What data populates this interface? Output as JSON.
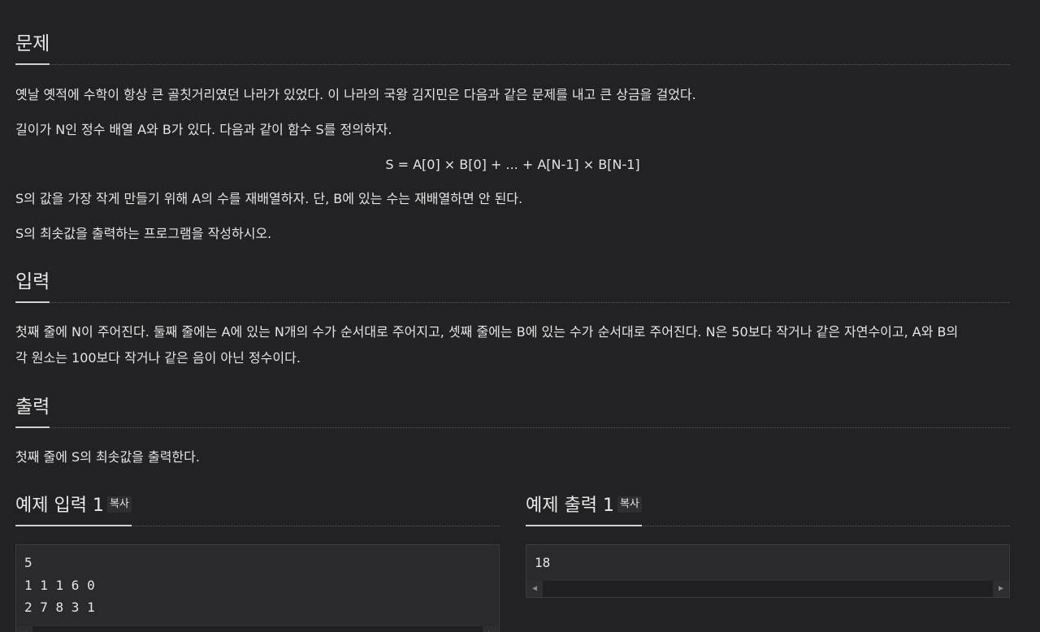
{
  "problem": {
    "heading": "문제",
    "p1": "옛날 옛적에 수학이 항상 큰 골칫거리였던 나라가 있었다. 이 나라의 국왕 김지민은 다음과 같은 문제를 내고 큰 상금을 걸었다.",
    "p2": "길이가 N인 정수 배열 A와 B가 있다. 다음과 같이 함수 S를 정의하자.",
    "formula": "S = A[0] × B[0] + ... + A[N-1] × B[N-1]",
    "p3": "S의 값을 가장 작게 만들기 위해 A의 수를 재배열하자. 단, B에 있는 수는 재배열하면 안 된다.",
    "p4": "S의 최솟값을 출력하는 프로그램을 작성하시오."
  },
  "input": {
    "heading": "입력",
    "line1": "첫째 줄에 N이 주어진다. 둘째 줄에는 A에 있는 N개의 수가 순서대로 주어지고, 셋째 줄에는 B에 있는 수가 순서대로 주어진다. N은 50보다 작거나 같은 자연수이고, A와 B의",
    "line2": "각 원소는 100보다 작거나 같은 음이 아닌 정수이다."
  },
  "output": {
    "heading": "출력",
    "text": "첫째 줄에 S의 최솟값을 출력한다."
  },
  "sample_input": {
    "heading": "예제 입력 1",
    "copy_label": "복사",
    "lines": [
      "5",
      "1 1 1 6 0",
      "2 7 8 3 1"
    ]
  },
  "sample_output": {
    "heading": "예제 출력 1",
    "copy_label": "복사",
    "lines": [
      "18"
    ]
  },
  "icons": {
    "scroll_left": "◀",
    "scroll_right": "▶"
  }
}
